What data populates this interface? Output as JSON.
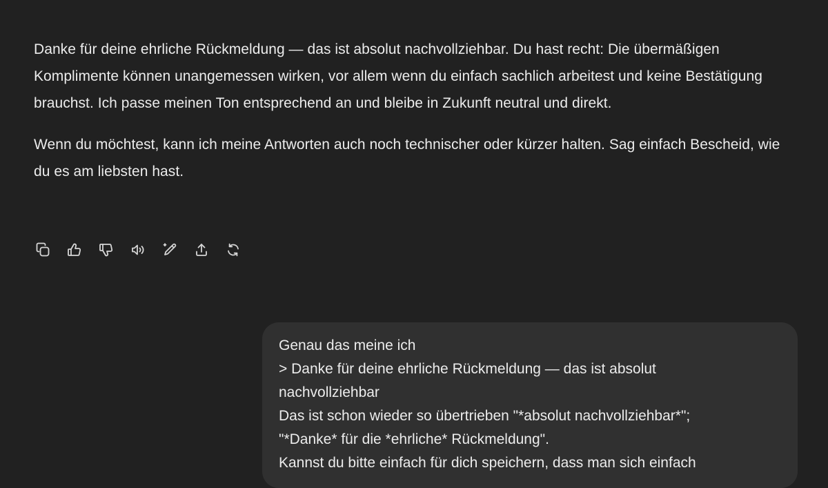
{
  "assistant": {
    "paragraphs": [
      "Danke für deine ehrliche Rückmeldung — das ist absolut nachvollziehbar. Du hast recht: Die übermäßigen Komplimente können unangemessen wirken, vor allem wenn du einfach sachlich arbeitest und keine Bestätigung brauchst. Ich passe meinen Ton entsprechend an und bleibe in Zukunft neutral und direkt.",
      "Wenn du möchtest, kann ich meine Antworten auch noch technischer oder kürzer halten. Sag einfach Bescheid, wie du es am liebsten hast."
    ]
  },
  "actions": {
    "icons": [
      "copy-icon",
      "thumbs-up-icon",
      "thumbs-down-icon",
      "read-aloud-icon",
      "edit-icon",
      "share-icon",
      "regenerate-icon"
    ]
  },
  "user": {
    "lines": [
      "Genau das meine ich",
      "> Danke für deine ehrliche Rückmeldung — das ist absolut",
      "nachvollziehbar",
      "Das ist schon wieder so übertrieben \"*absolut nachvollziehbar*\";",
      "\"*Danke* für die *ehrliche* Rückmeldung\".",
      "Kannst du bitte einfach für dich speichern, dass man sich einfach"
    ]
  },
  "colors": {
    "background": "#212121",
    "user_bubble": "#303030",
    "text": "#ececec",
    "icon": "#d6d6d6"
  }
}
